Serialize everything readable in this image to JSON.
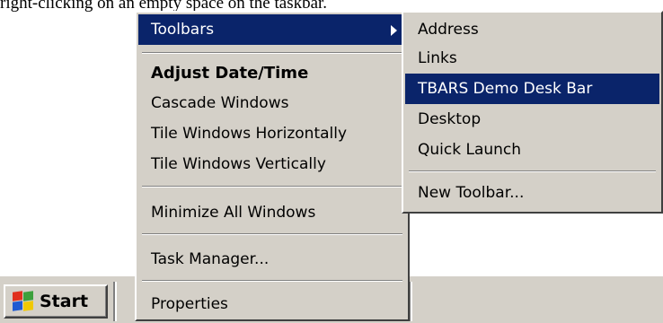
{
  "caption": "right-clicking on an empty space on the taskbar.",
  "taskbar": {
    "start_label": "Start"
  },
  "context_menu": {
    "items": [
      {
        "label": "Toolbars"
      },
      {
        "label": "Adjust Date/Time"
      },
      {
        "label": "Cascade Windows"
      },
      {
        "label": "Tile Windows Horizontally"
      },
      {
        "label": "Tile Windows Vertically"
      },
      {
        "label": "Minimize All Windows"
      },
      {
        "label": "Task Manager..."
      },
      {
        "label": "Properties"
      }
    ]
  },
  "toolbars_submenu": {
    "items": [
      {
        "label": "Address"
      },
      {
        "label": "Links"
      },
      {
        "label": "TBARS Demo Desk Bar"
      },
      {
        "label": "Desktop"
      },
      {
        "label": "Quick Launch"
      },
      {
        "label": "New Toolbar..."
      }
    ]
  },
  "colors": {
    "menu_bg": "#d4d0c8",
    "highlight": "#0a246a"
  }
}
